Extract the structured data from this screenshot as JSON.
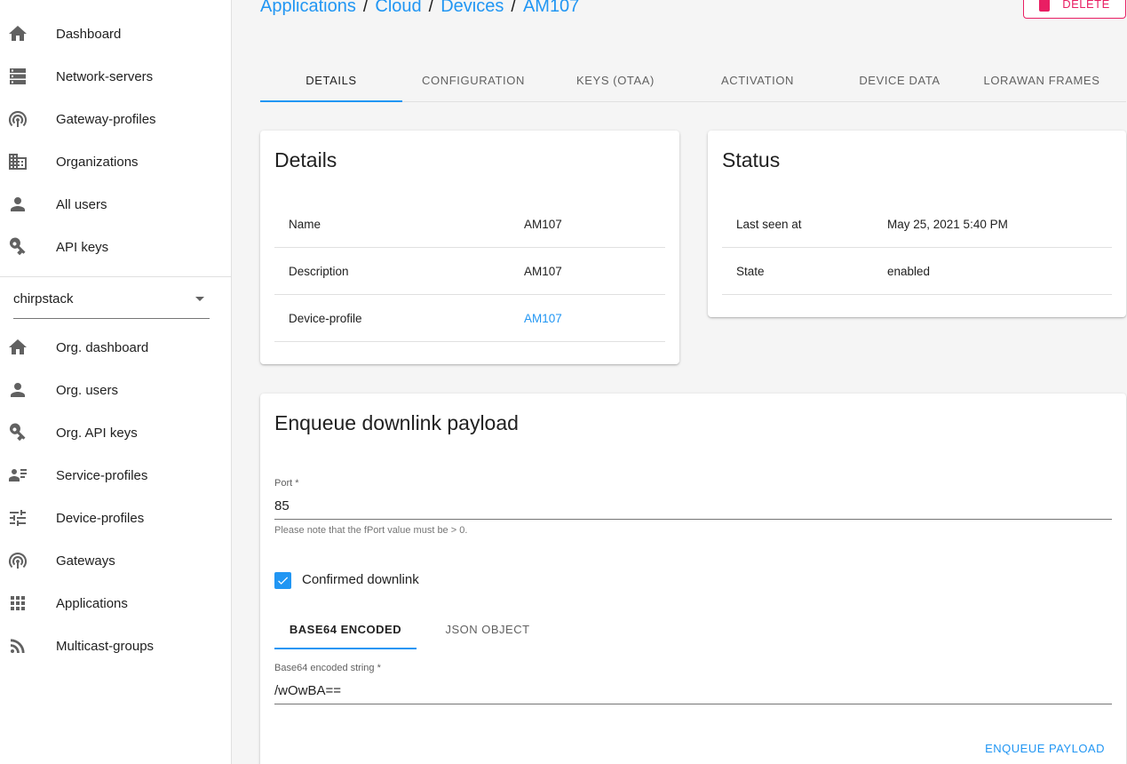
{
  "sidebar": {
    "top_items": [
      {
        "label": "Dashboard",
        "icon": "home-icon"
      },
      {
        "label": "Network-servers",
        "icon": "server-icon"
      },
      {
        "label": "Gateway-profiles",
        "icon": "antenna-icon"
      },
      {
        "label": "Organizations",
        "icon": "domain-icon"
      },
      {
        "label": "All users",
        "icon": "person-icon"
      },
      {
        "label": "API keys",
        "icon": "key-icon"
      }
    ],
    "org_select": {
      "value": "chirpstack"
    },
    "org_items": [
      {
        "label": "Org. dashboard",
        "icon": "home-icon"
      },
      {
        "label": "Org. users",
        "icon": "person-icon"
      },
      {
        "label": "Org. API keys",
        "icon": "key-icon"
      },
      {
        "label": "Service-profiles",
        "icon": "account-details-icon"
      },
      {
        "label": "Device-profiles",
        "icon": "tune-icon"
      },
      {
        "label": "Gateways",
        "icon": "antenna-icon"
      },
      {
        "label": "Applications",
        "icon": "apps-grid-icon"
      },
      {
        "label": "Multicast-groups",
        "icon": "rss-icon"
      }
    ]
  },
  "breadcrumb": {
    "items": [
      "Applications",
      "Cloud",
      "Devices",
      "AM107"
    ],
    "separator": "/"
  },
  "delete_button": {
    "label": "DELETE"
  },
  "tabs": [
    "DETAILS",
    "CONFIGURATION",
    "KEYS (OTAA)",
    "ACTIVATION",
    "DEVICE DATA",
    "LORAWAN FRAMES"
  ],
  "details_card": {
    "title": "Details",
    "rows": [
      {
        "key": "Name",
        "value": "AM107"
      },
      {
        "key": "Description",
        "value": "AM107"
      },
      {
        "key": "Device-profile",
        "value": "AM107"
      }
    ]
  },
  "status_card": {
    "title": "Status",
    "rows": [
      {
        "key": "Last seen at",
        "value": "May 25, 2021 5:40 PM"
      },
      {
        "key": "State",
        "value": "enabled"
      }
    ]
  },
  "downlink_card": {
    "title": "Enqueue downlink payload",
    "port_label": "Port *",
    "port_value": "85",
    "port_helper": "Please note that the fPort value must be > 0.",
    "confirmed_label": "Confirmed downlink",
    "confirmed_checked": true,
    "payload_tabs": [
      "BASE64 ENCODED",
      "JSON OBJECT"
    ],
    "base64_label": "Base64 encoded string *",
    "base64_value": "/wOwBA==",
    "submit_label": "ENQUEUE PAYLOAD"
  },
  "colors": {
    "accent": "#2196f3",
    "danger": "#e91e63"
  }
}
